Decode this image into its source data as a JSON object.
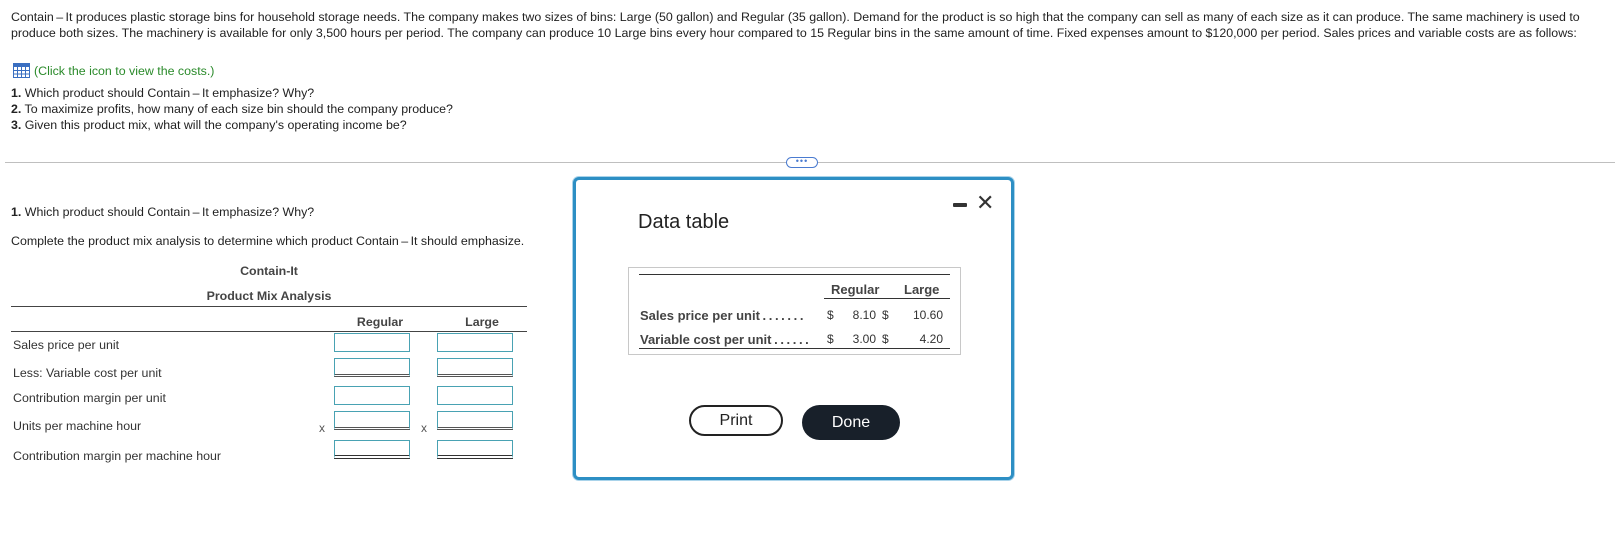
{
  "intro": "Contain – It produces plastic storage bins for household storage needs. The company makes two sizes of bins: Large (50 gallon) and Regular (35 gallon). Demand for the product is so high that the company can sell as many of each size as it can produce. The same machinery is used to produce both sizes. The machinery is available for only 3,500 hours per period. The company can produce 10 Large bins every hour compared to 15 Regular bins in the same amount of time. Fixed expenses amount to $120,000 per period. Sales prices and variable costs are as follows:",
  "costs_link": "(Click the icon to view the costs.)",
  "questions": [
    {
      "num": "1.",
      "text": " Which product should Contain – It emphasize? Why?"
    },
    {
      "num": "2.",
      "text": " To maximize profits, how many of each size bin should the company produce?"
    },
    {
      "num": "3.",
      "text": " Given this product mix, what will the company's operating income be?"
    }
  ],
  "more_label": "•••",
  "section": {
    "q_num": "1.",
    "q_text": " Which product should Contain – It emphasize? Why?",
    "instruction": "Complete the product mix analysis to determine which product Contain – It should emphasize."
  },
  "analysis": {
    "company": "Contain-It",
    "title": "Product Mix Analysis",
    "col_regular": "Regular",
    "col_large": "Large",
    "rows": [
      {
        "label": "Sales price per unit"
      },
      {
        "label": "Less: Variable cost per unit"
      },
      {
        "label": "Contribution margin per unit"
      },
      {
        "label": "Units per machine hour",
        "op": "x"
      },
      {
        "label": "Contribution margin per machine hour"
      }
    ]
  },
  "modal": {
    "title": "Data table",
    "col_regular": "Regular",
    "col_large": "Large",
    "rows": [
      {
        "label": "Sales price per unit",
        "dots": " . . . . . . .",
        "cur1": "$",
        "regular": "8.10",
        "cur2": "$",
        "large": "10.60"
      },
      {
        "label": "Variable cost per unit",
        "dots": " . . . . . .",
        "cur1": "$",
        "regular": "3.00",
        "cur2": "$",
        "large": "4.20"
      }
    ],
    "print_label": "Print",
    "done_label": "Done",
    "close_glyph": "✕"
  },
  "colors": {
    "link_green": "#2a8a2a",
    "modal_border": "#2d8fc4",
    "input_border": "#49a2b3",
    "done_bg": "#18202a"
  }
}
